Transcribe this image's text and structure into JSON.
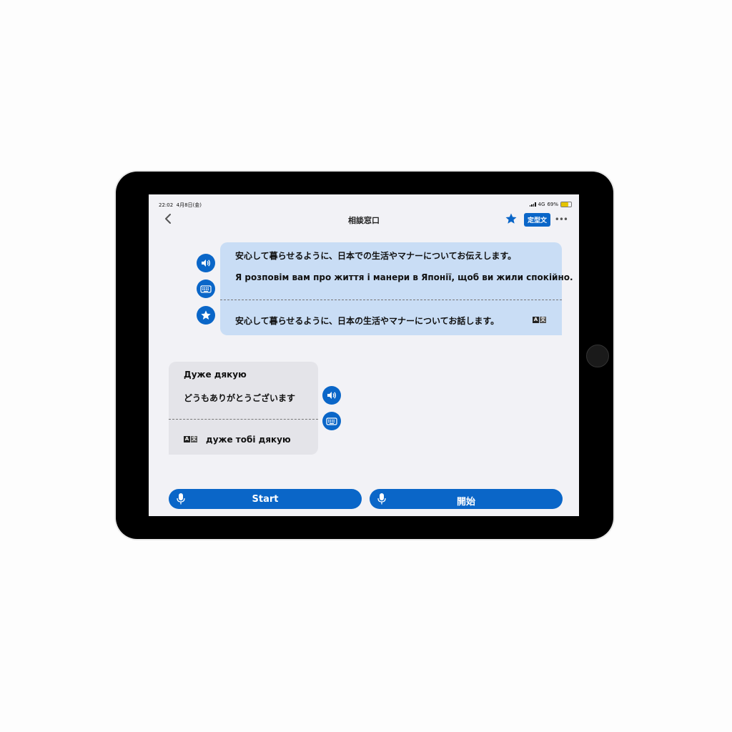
{
  "status_bar": {
    "time": "22:02",
    "date": "4月8日(金)",
    "network": "4G",
    "battery": "69%",
    "battery_level": 0.69
  },
  "nav": {
    "title": "相談窓口",
    "phrase_label": "定型文",
    "more_label": "•••"
  },
  "message_right": {
    "original": "安心して暮らせるように、日本での生活やマナーについてお伝えします。",
    "translation": "Я розповім вам про життя і манери в Японії, щоб ви жили спокійно.",
    "back_translation": "安心して暮らせるように、日本の生活やマナーについてお話します。"
  },
  "message_left": {
    "original": "Дуже дякую",
    "translation": "どうもありがとうございます",
    "back_translation": "дуже тобі дякую"
  },
  "translate_icon": {
    "a": "A",
    "b": "文"
  },
  "buttons": {
    "start_left": "Start",
    "start_right": "開始"
  },
  "colors": {
    "accent": "#0a66c8",
    "bubble_right": "#c9ddf5",
    "bubble_left": "#e4e4e9"
  },
  "icons": {
    "speaker": "speaker-icon",
    "keyboard": "keyboard-icon",
    "star": "star-icon",
    "mic": "mic-icon",
    "back": "chevron-left-icon"
  }
}
